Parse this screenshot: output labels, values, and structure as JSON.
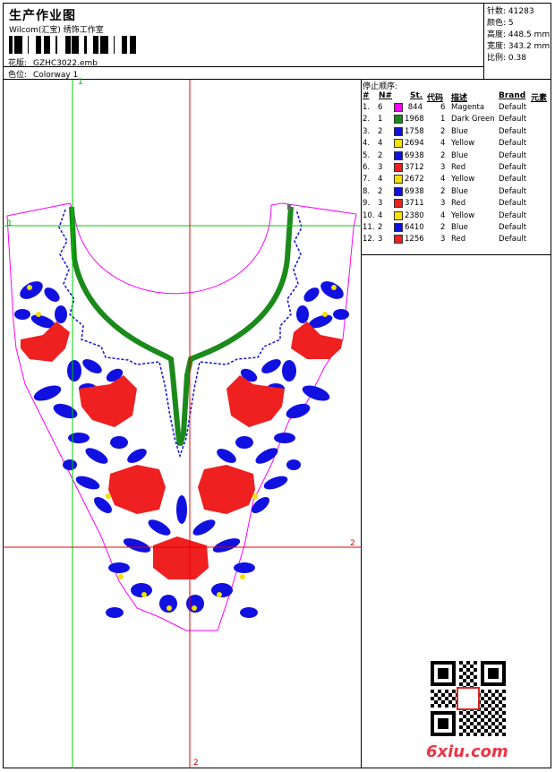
{
  "header": {
    "title": "生产作业图",
    "subtitle": "Wilcom(汇宝) 绣饰工作室",
    "pattern_label": "花版:",
    "pattern_value": "GZHC3022.emb",
    "colorway_label": "色位:",
    "colorway_value": "Colorway 1"
  },
  "stats": [
    {
      "label": "针数:",
      "value": "41283"
    },
    {
      "label": "颜色:",
      "value": "5"
    },
    {
      "label": "高度:",
      "value": "448.5 mm"
    },
    {
      "label": "宽度:",
      "value": "343.2 mm"
    },
    {
      "label": "比例:",
      "value": "0.38"
    }
  ],
  "stop_sequence": {
    "title": "停止顺序:",
    "columns": [
      "#",
      "N#",
      "St.",
      "代码",
      "描述",
      "Brand",
      "元素"
    ],
    "rows": [
      {
        "idx": "1.",
        "n": "6",
        "st": "844",
        "code": "6",
        "desc": "Magenta",
        "brand": "Default",
        "color": "#ff00ff"
      },
      {
        "idx": "2.",
        "n": "1",
        "st": "1968",
        "code": "1",
        "desc": "Dark Green",
        "brand": "Default",
        "color": "#1a8a1a"
      },
      {
        "idx": "3.",
        "n": "2",
        "st": "1758",
        "code": "2",
        "desc": "Blue",
        "brand": "Default",
        "color": "#1010e0"
      },
      {
        "idx": "4.",
        "n": "4",
        "st": "2694",
        "code": "4",
        "desc": "Yellow",
        "brand": "Default",
        "color": "#f5e000"
      },
      {
        "idx": "5.",
        "n": "2",
        "st": "6938",
        "code": "2",
        "desc": "Blue",
        "brand": "Default",
        "color": "#1010e0"
      },
      {
        "idx": "6.",
        "n": "3",
        "st": "3712",
        "code": "3",
        "desc": "Red",
        "brand": "Default",
        "color": "#ee2020"
      },
      {
        "idx": "7.",
        "n": "4",
        "st": "2672",
        "code": "4",
        "desc": "Yellow",
        "brand": "Default",
        "color": "#f5e000"
      },
      {
        "idx": "8.",
        "n": "2",
        "st": "6938",
        "code": "2",
        "desc": "Blue",
        "brand": "Default",
        "color": "#1010e0"
      },
      {
        "idx": "9.",
        "n": "3",
        "st": "3711",
        "code": "3",
        "desc": "Red",
        "brand": "Default",
        "color": "#ee2020"
      },
      {
        "idx": "10.",
        "n": "4",
        "st": "2380",
        "code": "4",
        "desc": "Yellow",
        "brand": "Default",
        "color": "#f5e000"
      },
      {
        "idx": "11.",
        "n": "2",
        "st": "6410",
        "code": "2",
        "desc": "Blue",
        "brand": "Default",
        "color": "#1010e0"
      },
      {
        "idx": "12.",
        "n": "3",
        "st": "1256",
        "code": "3",
        "desc": "Red",
        "brand": "Default",
        "color": "#ee2020"
      }
    ]
  },
  "guides": {
    "v1": "1",
    "h1": "1",
    "h2": "2",
    "v2": "2"
  },
  "watermark": "6xiu.com",
  "colors": {
    "red": "#ee2020",
    "blue": "#1010e0",
    "green": "#1a8a1a",
    "yellow": "#f5e000",
    "magenta": "#ff00ff",
    "guide_green": "#00cc00",
    "guide_red": "#ee0000"
  }
}
